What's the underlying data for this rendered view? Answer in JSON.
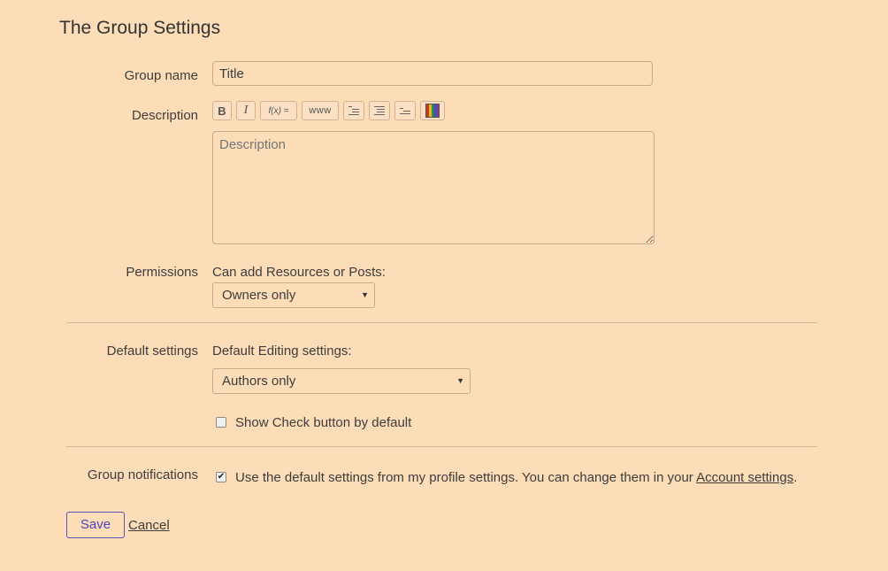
{
  "page_title": "The Group Settings",
  "group_name": {
    "label": "Group name",
    "value": "Title"
  },
  "description": {
    "label": "Description",
    "toolbar": {
      "bold": "B",
      "italic": "I",
      "formula": "f(x) =",
      "link": "www",
      "icons": [
        "bold-icon",
        "italic-icon",
        "formula-icon",
        "link-icon",
        "indent-icon",
        "numbered-list-icon",
        "bulleted-list-icon",
        "color-palette-icon"
      ]
    },
    "placeholder": "Description"
  },
  "permissions": {
    "label": "Permissions",
    "sub_label": "Can add Resources or Posts:",
    "selected": "Owners only"
  },
  "default_settings": {
    "label": "Default settings",
    "sub_label": "Default Editing settings:",
    "selected": "Authors only",
    "checkbox_label": "Show Check button by default",
    "checkbox_checked": false
  },
  "group_notifications": {
    "label": "Group notifications",
    "text_before": "Use the default settings from my profile settings. You can change them in your ",
    "link_text": "Account settings",
    "text_after": ".",
    "checked": true
  },
  "actions": {
    "save": "Save",
    "cancel": "Cancel"
  },
  "colors": {
    "background": "#fddcb8",
    "accent": "#4a44c0"
  }
}
